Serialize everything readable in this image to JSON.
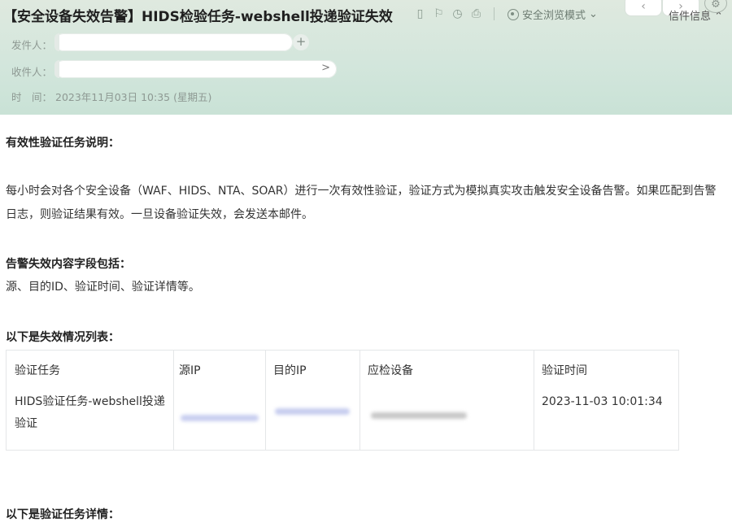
{
  "header": {
    "subject": "【安全设备失效告警】HIDS检验任务-webshell投递验证失效",
    "toolbar_icons": [
      "bookmark-icon",
      "flag-icon",
      "clock-icon",
      "print-icon"
    ],
    "safe_mode_label": "安全浏览模式",
    "nav": {
      "prev": "‹",
      "next": "›"
    },
    "letter_info_label": "信件信息",
    "sender_label": "发件人：",
    "recipient_label": "收件人：",
    "time_label": "时　间：",
    "time_value": "2023年11月03日 10:35 (星期五)",
    "add_symbol": "+",
    "expand_symbol": ">"
  },
  "body": {
    "section1_title": "有效性验证任务说明：",
    "section1_text": "每小时会对各个安全设备（WAF、HIDS、NTA、SOAR）进行一次有效性验证，验证方式为模拟真实攻击触发安全设备告警。如果匹配到告警日志，则验证结果有效。一旦设备验证失效，会发送本邮件。",
    "section2_title": "告警失效内容字段包括：",
    "section2_text": "源、目的ID、验证时间、验证详情等。",
    "section3_title": "以下是失效情况列表：",
    "table": {
      "headers": [
        "验证任务",
        "源IP",
        "目的IP",
        "应检设备",
        "验证时间"
      ],
      "row": {
        "task": "HIDS验证任务-webshell投递验证",
        "time": "2023-11-03 10:01:34"
      }
    },
    "section4_title": "以下是验证任务详情："
  }
}
